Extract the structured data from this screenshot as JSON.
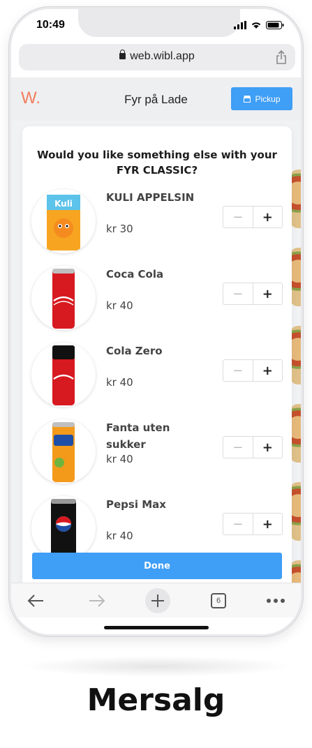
{
  "status_bar": {
    "time": "10:49"
  },
  "browser": {
    "url": "web.wibl.app",
    "tab_count": "6"
  },
  "header": {
    "logo": "W.",
    "venue": "Fyr på Lade",
    "pickup_label": "Pickup"
  },
  "modal": {
    "title": "Would you like something else with your FYR CLASSIC?",
    "items": [
      {
        "name": "KULI APPELSIN",
        "price": "kr 30",
        "image": "kuli-orange-carton"
      },
      {
        "name": "Coca Cola",
        "price": "kr 40",
        "image": "coca-cola-can"
      },
      {
        "name": "Cola Zero",
        "price": "kr 40",
        "image": "cola-zero-can"
      },
      {
        "name": "Fanta uten sukker",
        "price": "kr 40",
        "image": "fanta-can"
      },
      {
        "name": "Pepsi Max",
        "price": "kr 40",
        "image": "pepsi-max-can"
      }
    ],
    "minus_symbol": "−",
    "plus_symbol": "+",
    "done_label": "Done"
  },
  "caption": "Mersalg",
  "colors": {
    "accent": "#3f9ef5",
    "logo": "#f27c5c"
  }
}
